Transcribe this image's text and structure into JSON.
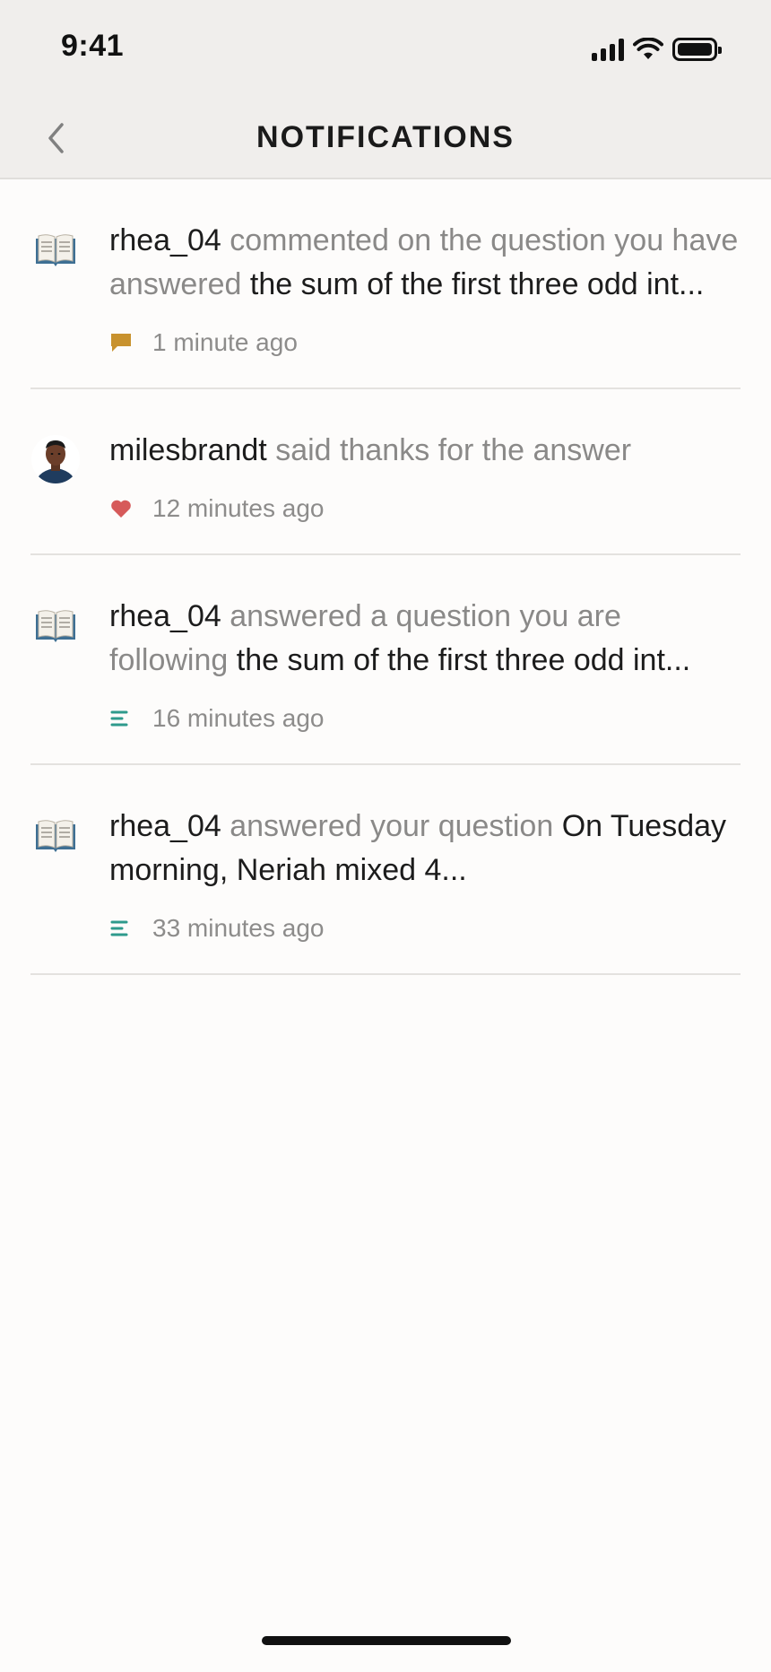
{
  "status_bar": {
    "time": "9:41"
  },
  "header": {
    "title": "NOTIFICATIONS"
  },
  "notifications": [
    {
      "user": "rhea_04",
      "action": "commented on the question you have answered",
      "subject": "the sum of the first three odd int...",
      "time": "1 minute ago",
      "lead_icon": "book-icon",
      "meta_icon": "comment-icon",
      "meta_color": "#c8922e"
    },
    {
      "user": "milesbrandt",
      "action": "said thanks for the answer",
      "subject": "",
      "time": "12 minutes ago",
      "lead_icon": "avatar",
      "meta_icon": "heart-icon",
      "meta_color": "#d65a5a"
    },
    {
      "user": "rhea_04",
      "action": "answered a question you are following",
      "subject": "the sum of the first three odd int...",
      "time": "16 minutes ago",
      "lead_icon": "book-icon",
      "meta_icon": "answer-lines-icon",
      "meta_color": "#2e9a8c"
    },
    {
      "user": "rhea_04",
      "action": "answered your question",
      "subject": "On Tuesday morning, Neriah mixed 4...",
      "time": "33 minutes ago",
      "lead_icon": "book-icon",
      "meta_icon": "answer-lines-icon",
      "meta_color": "#2e9a8c"
    }
  ]
}
